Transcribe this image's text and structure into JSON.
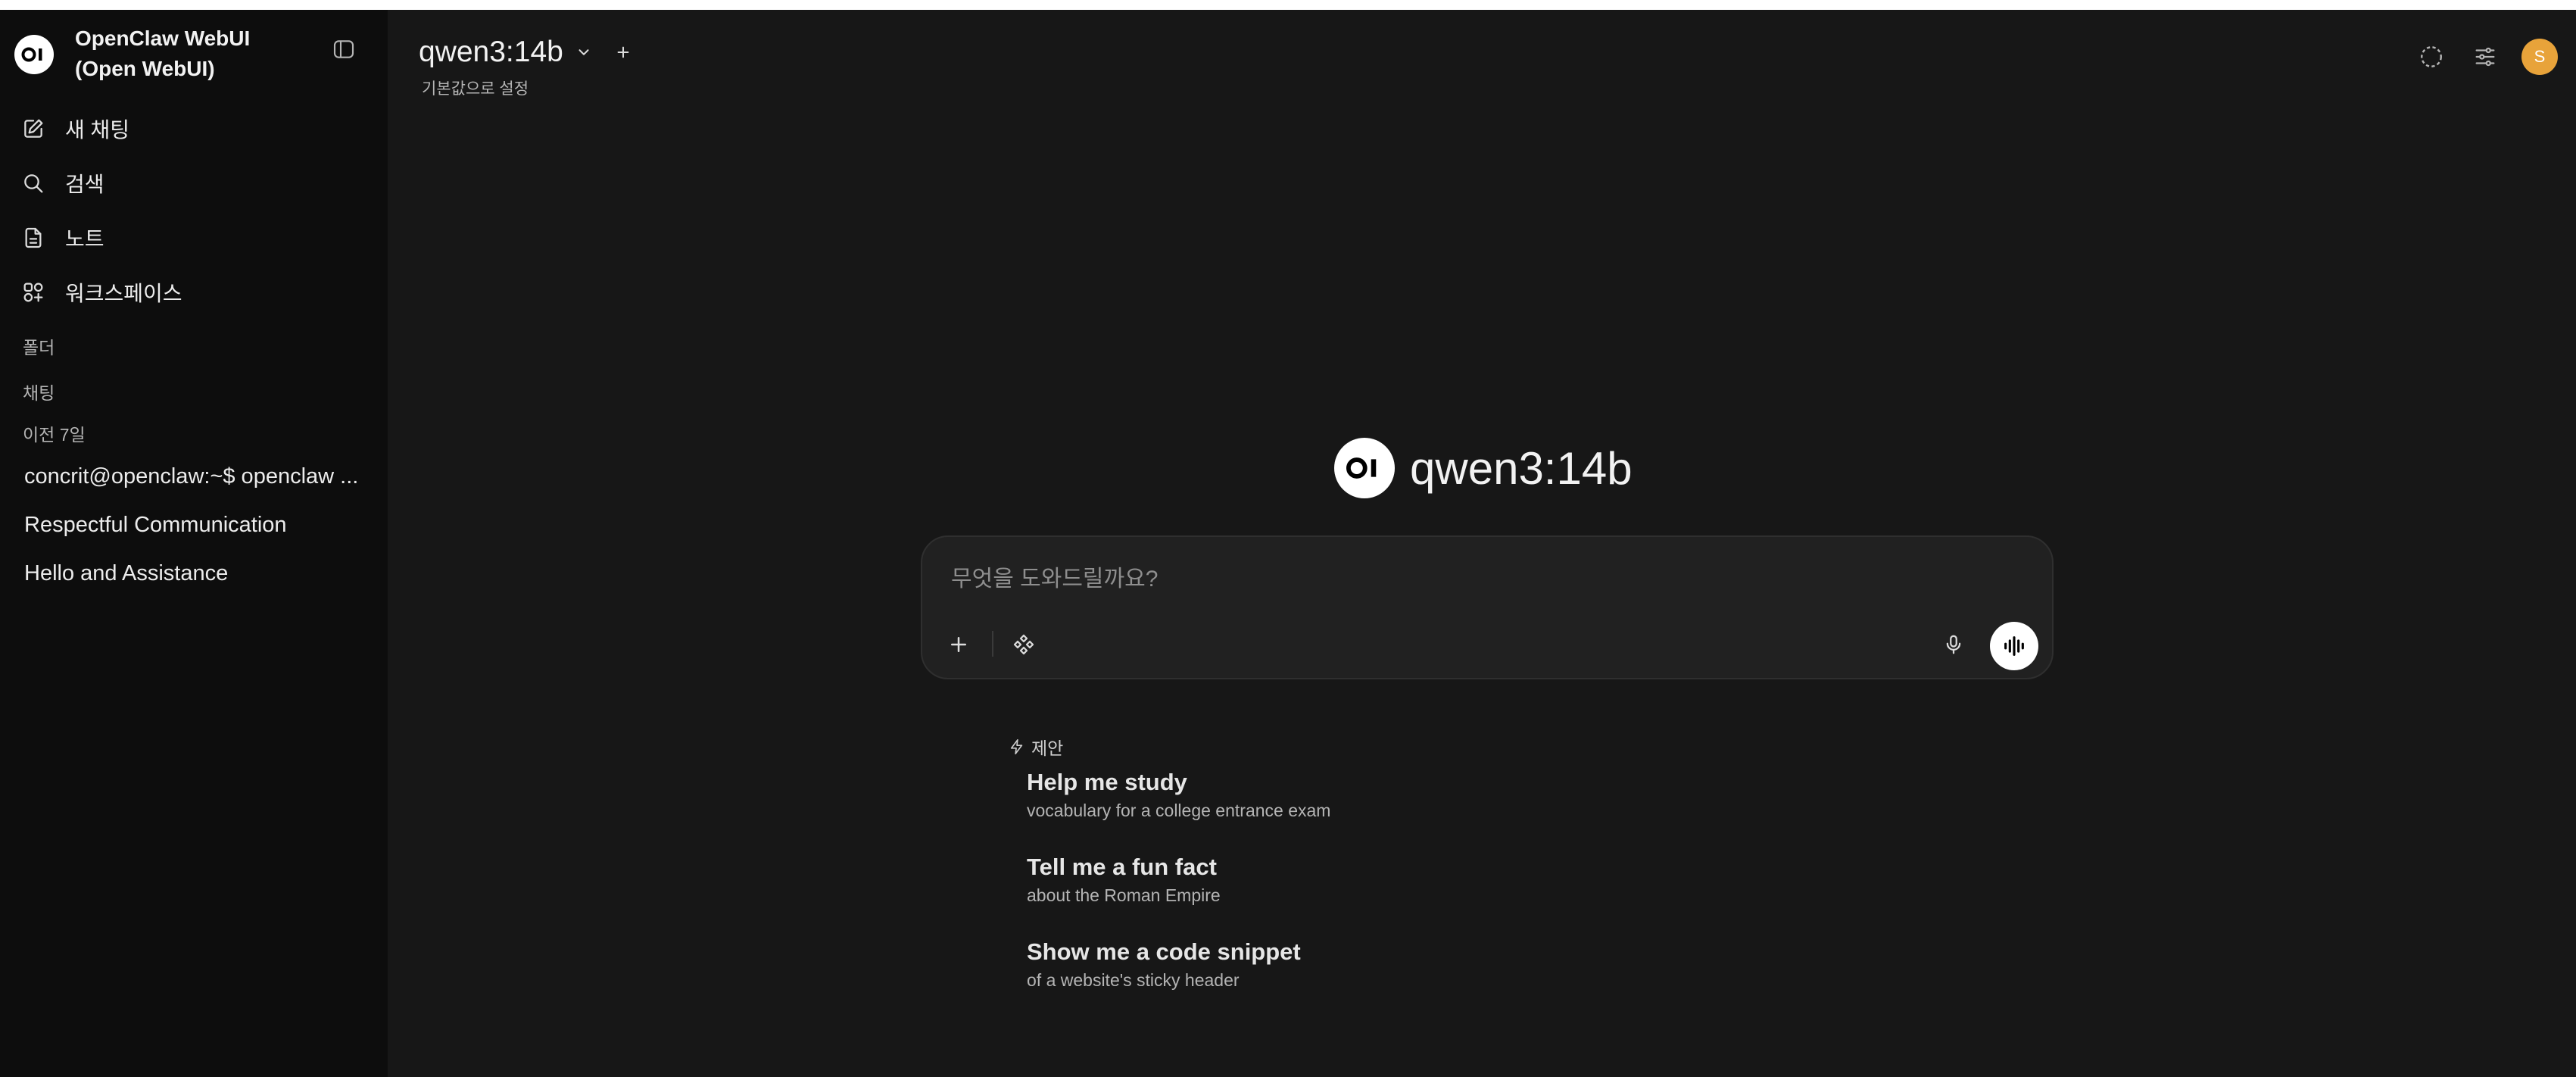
{
  "colors": {
    "app_background": "#171717",
    "sidebar_background": "#0d0d0d",
    "composer_background": "#212121",
    "avatar": "#e8a33a"
  },
  "sidebar": {
    "logo_text": "OI",
    "brand_line1": "OpenClaw WebUI",
    "brand_line2": "(Open WebUI)",
    "toggle_icon": "sidebar-panel-icon",
    "nav": [
      {
        "label": "새 채팅",
        "icon": "edit-icon"
      },
      {
        "label": "검색",
        "icon": "search-icon"
      },
      {
        "label": "노트",
        "icon": "notes-icon"
      },
      {
        "label": "워크스페이스",
        "icon": "workspace-icon"
      }
    ],
    "sections": {
      "folders": "폴더",
      "chats": "채팅",
      "previous_7_days": "이전 7일"
    },
    "chats": [
      "concrit@openclaw:~$ openclaw ...",
      "Respectful Communication",
      "Hello and Assistance"
    ]
  },
  "header": {
    "model_name": "qwen3:14b",
    "set_default": "기본값으로 설정",
    "avatar_initial": "S",
    "icons": [
      "temporary-chat-icon",
      "controls-icon"
    ]
  },
  "main": {
    "hero_logo_text": "OI",
    "hero_title": "qwen3:14b",
    "composer": {
      "placeholder": "무엇을 도와드릴까요?",
      "value": ""
    },
    "suggestions_label": "제안",
    "suggestions": [
      {
        "title": "Help me study",
        "subtitle": "vocabulary for a college entrance exam"
      },
      {
        "title": "Tell me a fun fact",
        "subtitle": "about the Roman Empire"
      },
      {
        "title": "Show me a code snippet",
        "subtitle": "of a website's sticky header"
      }
    ]
  }
}
